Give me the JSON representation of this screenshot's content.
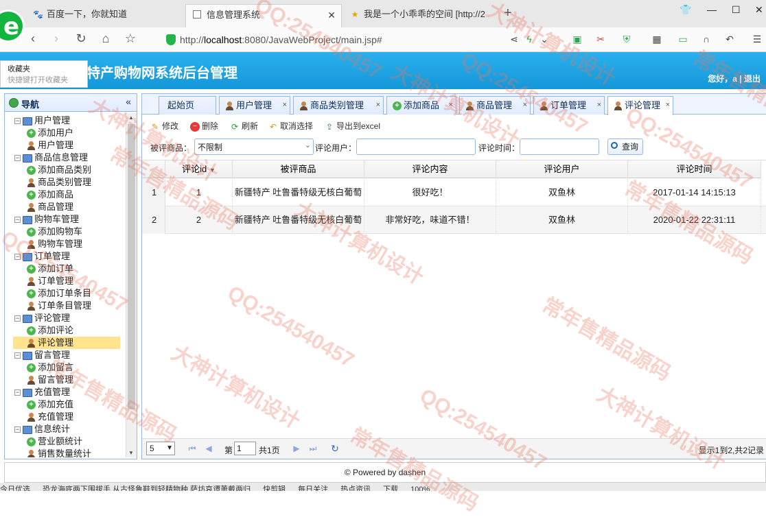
{
  "browser": {
    "tabs": [
      {
        "label": "百度一下，你就知道",
        "favicon": "paw-icon"
      },
      {
        "label": "信息管理系统",
        "favicon": "page-icon"
      },
      {
        "label": "我是一个小乖乖的空间 [http://2",
        "favicon": "star-icon"
      }
    ],
    "url_protocol": "http://",
    "url_host": "localhost",
    "url_rest": ":8080/JavaWebProject/main.jsp#"
  },
  "favorites_popup": {
    "title": "收藏夹",
    "hint": "快捷键打开收藏夹"
  },
  "app": {
    "title": "特产购物网系统后台管理",
    "user_greeting": "您好，a | 退出"
  },
  "nav": {
    "title": "导航",
    "collapse_icon": "«",
    "groups": [
      {
        "label": "用户管理",
        "items": [
          "添加用户",
          "用户管理"
        ]
      },
      {
        "label": "商品信息管理",
        "items": [
          "添加商品类别",
          "商品类别管理",
          "添加商品",
          "商品管理"
        ]
      },
      {
        "label": "购物车管理",
        "items": [
          "添加购物车",
          "购物车管理"
        ]
      },
      {
        "label": "订单管理",
        "items": [
          "添加订单",
          "订单管理",
          "添加订单条目",
          "订单条目管理"
        ]
      },
      {
        "label": "评论管理",
        "items": [
          "添加评论",
          "评论管理"
        ]
      },
      {
        "label": "留言管理",
        "items": [
          "添加留言",
          "留言管理"
        ]
      },
      {
        "label": "充值管理",
        "items": [
          "添加充值",
          "充值管理"
        ]
      },
      {
        "label": "信息统计",
        "items": [
          "营业额统计",
          "销售数量统计"
        ]
      }
    ],
    "selected": "评论管理"
  },
  "content_tabs": [
    "起始页",
    "用户管理",
    "商品类别管理",
    "添加商品",
    "商品管理",
    "订单管理",
    "评论管理"
  ],
  "toolbar": {
    "edit": "修改",
    "delete": "删除",
    "refresh": "刷新",
    "cancel_select": "取消选择",
    "export": "导出到excel"
  },
  "filters": {
    "product_label": "被评商品：",
    "product_value": "不限制",
    "user_label": "评论用户：",
    "user_value": "",
    "time_label": "评论时间：",
    "time_value": "",
    "search_label": "查询"
  },
  "grid": {
    "columns": [
      "评论id",
      "被评商品",
      "评论内容",
      "评论用户",
      "评论时间"
    ],
    "sort_indicator": "▼",
    "rows": [
      {
        "rownum": "1",
        "id": "1",
        "product": "新疆特产 吐鲁番特级无核白葡萄",
        "content": "很好吃！",
        "user": "双鱼林",
        "time": "2017-01-14 14:15:13"
      },
      {
        "rownum": "2",
        "id": "2",
        "product": "新疆特产 吐鲁番特级无核白葡萄",
        "content": "非常好吃，味道不错！",
        "user": "双鱼林",
        "time": "2020-01-22 22:31:11"
      }
    ]
  },
  "pager": {
    "page_size": "5",
    "page_prefix": "第",
    "page_number": "1",
    "page_total": "共1页",
    "info": "显示1到2,共2记录"
  },
  "footer": {
    "text": "© Powered by dashen"
  },
  "statusbar": [
    "今日优选",
    "恐龙海底两下围拔手 从古怪鲁鞋到轻精物种 萨坊哀谭萧戴两归",
    "快剪辑",
    "每日关注",
    "热点资讯",
    "下载",
    "100%"
  ],
  "watermark": [
    "QQ:254540457",
    "大神计算机设计",
    "常年售精品源码"
  ]
}
